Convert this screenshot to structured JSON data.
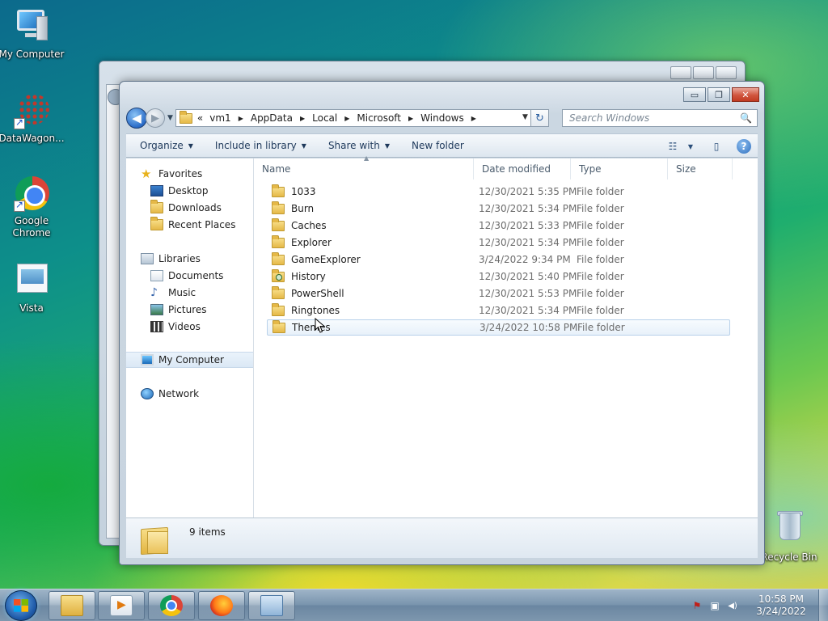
{
  "desktop": {
    "icons": [
      {
        "label": "My Computer",
        "icon": "computer-icon"
      },
      {
        "label": "DataWagon...",
        "icon": "datawagon-shortcut-icon"
      },
      {
        "label": "Google Chrome",
        "icon": "chrome-icon"
      },
      {
        "label": "Vista",
        "icon": "vista-document-icon"
      },
      {
        "label": "Recycle Bin",
        "icon": "recycle-bin-icon"
      }
    ]
  },
  "window": {
    "caption_buttons": {
      "minimize": "▭",
      "maximize": "❐",
      "close": "✕"
    },
    "nav": {
      "back": "◀",
      "forward": "▶",
      "history_drop": "▼"
    },
    "breadcrumb": {
      "lead": "«",
      "items": [
        "vm1",
        "AppData",
        "Local",
        "Microsoft",
        "Windows"
      ],
      "separator": "▶"
    },
    "address_drop": "▼",
    "refresh": "↻",
    "search": {
      "placeholder": "Search Windows",
      "icon": "🔍"
    },
    "toolbar": {
      "organize": "Organize",
      "include_in_library": "Include in library",
      "share_with": "Share with",
      "new_folder": "New folder",
      "caret": "▼",
      "views_icon": "☷",
      "views_caret": "▼",
      "preview_pane_icon": "▯",
      "help": "?"
    },
    "nav_pane": {
      "favorites": {
        "label": "Favorites",
        "items": [
          "Desktop",
          "Downloads",
          "Recent Places"
        ]
      },
      "libraries": {
        "label": "Libraries",
        "items": [
          "Documents",
          "Music",
          "Pictures",
          "Videos"
        ]
      },
      "computer": "My Computer",
      "network": "Network"
    },
    "columns": {
      "name": "Name",
      "date_modified": "Date modified",
      "type": "Type",
      "size": "Size",
      "sort_arrow": "▲"
    },
    "files": [
      {
        "name": "1033",
        "date": "12/30/2021 5:35 PM",
        "type": "File folder"
      },
      {
        "name": "Burn",
        "date": "12/30/2021 5:34 PM",
        "type": "File folder"
      },
      {
        "name": "Caches",
        "date": "12/30/2021 5:33 PM",
        "type": "File folder"
      },
      {
        "name": "Explorer",
        "date": "12/30/2021 5:34 PM",
        "type": "File folder"
      },
      {
        "name": "GameExplorer",
        "date": "3/24/2022 9:34 PM",
        "type": "File folder"
      },
      {
        "name": "History",
        "date": "12/30/2021 5:40 PM",
        "type": "File folder"
      },
      {
        "name": "PowerShell",
        "date": "12/30/2021 5:53 PM",
        "type": "File folder"
      },
      {
        "name": "Ringtones",
        "date": "12/30/2021 5:34 PM",
        "type": "File folder"
      },
      {
        "name": "Themes",
        "date": "3/24/2022 10:58 PM",
        "type": "File folder"
      }
    ],
    "status": {
      "items_count": "9 items"
    }
  },
  "taskbar": {
    "pinned": [
      "windows-explorer",
      "windows-media-player",
      "google-chrome",
      "firefox",
      "remote-desktop"
    ],
    "tray": {
      "action_center": "⚑",
      "network": "▣",
      "volume": "◀)"
    },
    "clock": {
      "time": "10:58 PM",
      "date": "3/24/2022"
    }
  }
}
